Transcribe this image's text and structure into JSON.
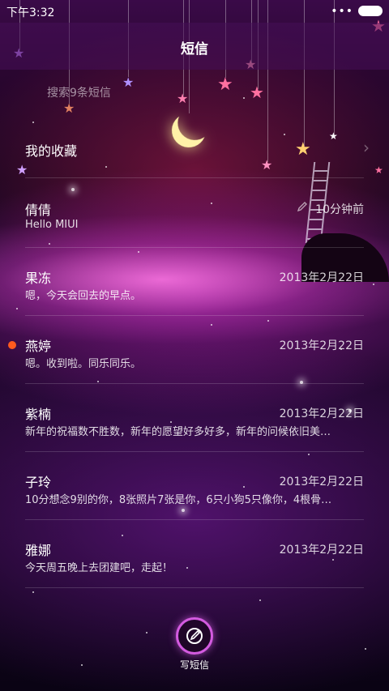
{
  "status_bar": {
    "time": "下午3:32",
    "dots": "•••"
  },
  "header": {
    "title": "短信"
  },
  "search": {
    "placeholder": "搜索9条短信"
  },
  "favorites": {
    "label": "我的收藏",
    "chevron": "›"
  },
  "conversations": [
    {
      "name": "倩倩",
      "date": "10分钟前",
      "preview": "Hello MIUI",
      "unread": false,
      "draft_icon": true
    },
    {
      "name": "果冻",
      "date": "2013年2月22日",
      "preview": "嗯，今天会回去的早点。",
      "unread": false
    },
    {
      "name": "燕婷",
      "date": "2013年2月22日",
      "preview": "嗯。收到啦。同乐同乐。",
      "unread": true
    },
    {
      "name": "紫楠",
      "date": "2013年2月22日",
      "preview": "新年的祝福数不胜数，新年的愿望好多好多，新年的问候依旧美…",
      "unread": false
    },
    {
      "name": "子玲",
      "date": "2013年2月22日",
      "preview": "10分想念9别的你，8张照片7张是你，6只小狗5只像你，4根骨…",
      "unread": false
    },
    {
      "name": "雅娜",
      "date": "2013年2月22日",
      "preview": "今天周五晚上去团建吧，走起！",
      "unread": false
    }
  ],
  "compose": {
    "label": "写短信",
    "icon": "compose-icon"
  },
  "colors": {
    "unread_dot": "#ff5a1e",
    "compose_ring": "#d35be0"
  }
}
